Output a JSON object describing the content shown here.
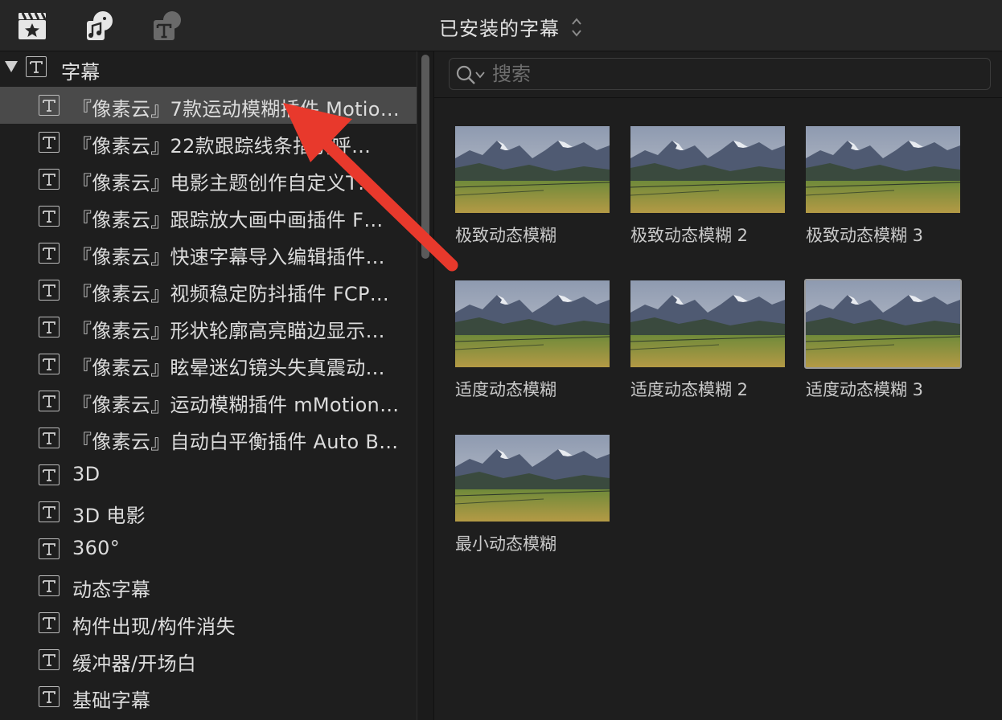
{
  "toolbar": {
    "icons": [
      {
        "name": "photos-and-audio-clapper-icon"
      },
      {
        "name": "music-and-sound-icon"
      },
      {
        "name": "titles-and-generators-icon"
      }
    ],
    "browser_title": "已安装的字幕"
  },
  "sidebar": {
    "header": {
      "label": "字幕",
      "expanded": true
    },
    "items": [
      {
        "label": "『像素云』7款运动模糊插件 Motio…",
        "selected": true
      },
      {
        "label": "『像素云』22款跟踪线条指引呼…",
        "selected": false
      },
      {
        "label": "『像素云』电影主题创作自定义T…",
        "selected": false
      },
      {
        "label": "『像素云』跟踪放大画中画插件 F…",
        "selected": false
      },
      {
        "label": "『像素云』快速字幕导入编辑插件…",
        "selected": false
      },
      {
        "label": "『像素云』视频稳定防抖插件 FCP…",
        "selected": false
      },
      {
        "label": "『像素云』形状轮廓高亮瞄边显示…",
        "selected": false
      },
      {
        "label": "『像素云』眩晕迷幻镜头失真震动…",
        "selected": false
      },
      {
        "label": "『像素云』运动模糊插件 mMotion…",
        "selected": false
      },
      {
        "label": "『像素云』自动白平衡插件 Auto B…",
        "selected": false
      },
      {
        "label": "3D",
        "selected": false
      },
      {
        "label": "3D 电影",
        "selected": false
      },
      {
        "label": "360°",
        "selected": false
      },
      {
        "label": "动态字幕",
        "selected": false
      },
      {
        "label": "构件出现/构件消失",
        "selected": false
      },
      {
        "label": "缓冲器/开场白",
        "selected": false
      },
      {
        "label": "基础字幕",
        "selected": false
      }
    ]
  },
  "search": {
    "placeholder": "搜索",
    "value": ""
  },
  "tiles": [
    {
      "label": "极致动态模糊",
      "selected": false
    },
    {
      "label": "极致动态模糊 2",
      "selected": false
    },
    {
      "label": "极致动态模糊 3",
      "selected": false
    },
    {
      "label": "适度动态模糊",
      "selected": false
    },
    {
      "label": "适度动态模糊 2",
      "selected": false
    },
    {
      "label": "适度动态模糊 3",
      "selected": true
    },
    {
      "label": "最小动态模糊",
      "selected": false
    }
  ],
  "colors": {
    "background": "#1e1e1e",
    "toolbar": "#262626",
    "selection": "#4a4a4a",
    "annotation_arrow": "#e8392c"
  }
}
